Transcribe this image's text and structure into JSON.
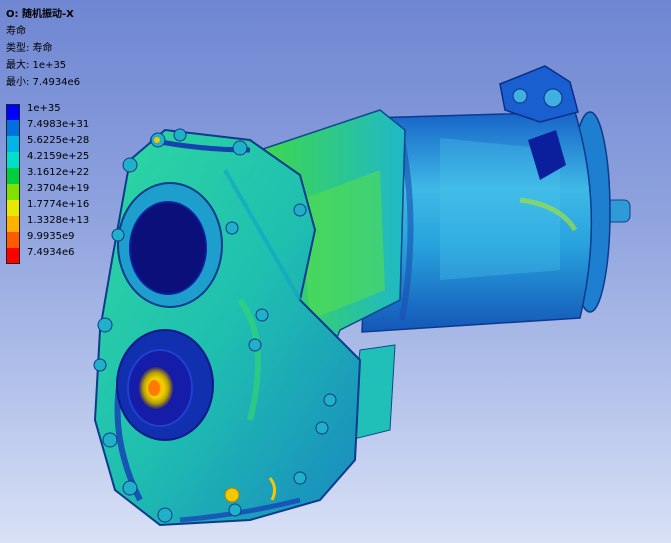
{
  "result": {
    "title": "O: 随机振动-X",
    "quantity": "寿命",
    "type_line": "类型: 寿命",
    "max_line": "最大: 1e+35",
    "min_line": "最小: 7.4934e6"
  },
  "legend": {
    "entries": [
      {
        "label": "1e+35",
        "color": "#0000ff"
      },
      {
        "label": "7.4983e+31",
        "color": "#0070e0"
      },
      {
        "label": "5.6225e+28",
        "color": "#00b4e8"
      },
      {
        "label": "4.2159e+25",
        "color": "#00e0c8"
      },
      {
        "label": "3.1612e+22",
        "color": "#00d040"
      },
      {
        "label": "2.3704e+19",
        "color": "#80e000"
      },
      {
        "label": "1.7774e+16",
        "color": "#e8e800"
      },
      {
        "label": "1.3328e+13",
        "color": "#ffb000"
      },
      {
        "label": "9.9935e9",
        "color": "#ff5a00"
      },
      {
        "label": "7.4934e6",
        "color": "#ff0000"
      }
    ]
  },
  "model": {
    "palette": {
      "housing": "#21c9a8",
      "housing_dark": "#0e6f8a",
      "low_life": "#1010a8",
      "mid": "#3bd24a",
      "motor": "#1b8fd6",
      "motor_light": "#3fb9e6",
      "hot": "#ff8a00",
      "warn": "#e6e600"
    }
  }
}
